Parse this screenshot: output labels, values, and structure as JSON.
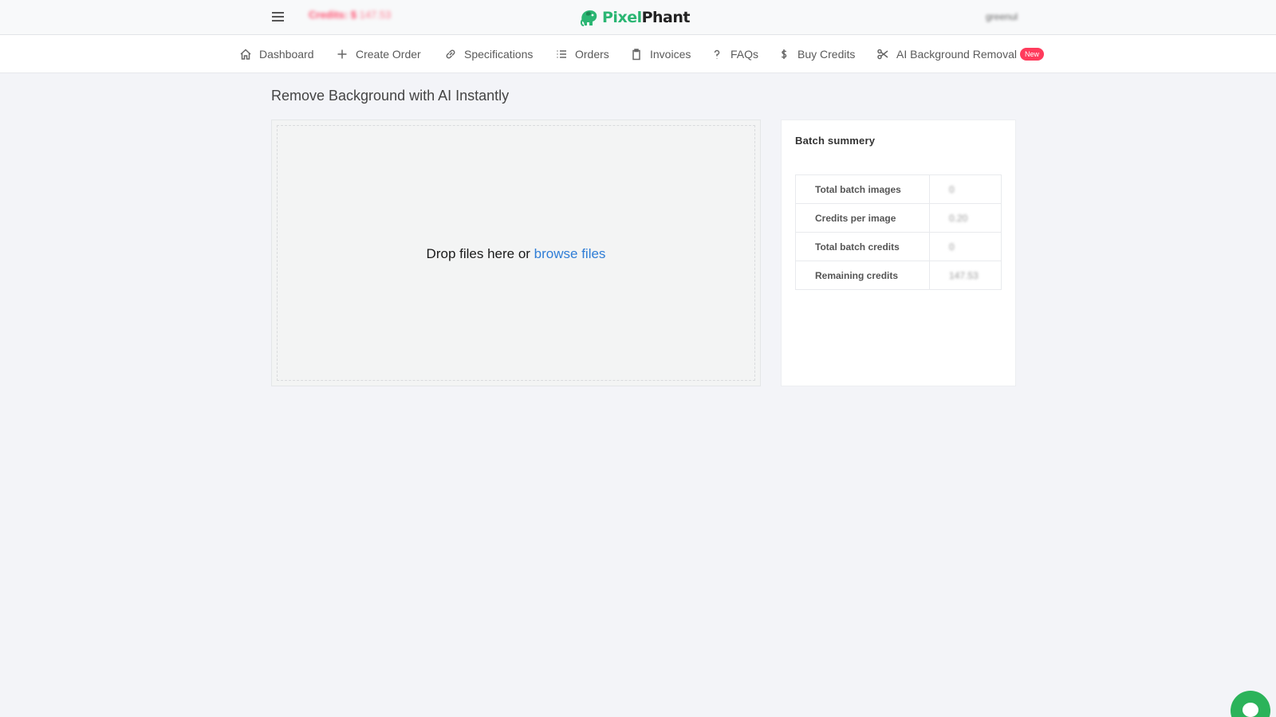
{
  "header": {
    "credits_label": "Credits: $",
    "credits_amount": "147.53",
    "logo_part1": "Pixel",
    "logo_part2": "Phant",
    "username": "greenul"
  },
  "nav": {
    "items": [
      {
        "label": "Dashboard",
        "icon": "home-icon"
      },
      {
        "label": "Create Order",
        "icon": "plus-icon"
      },
      {
        "label": "Specifications",
        "icon": "link-icon"
      },
      {
        "label": "Orders",
        "icon": "list-icon"
      },
      {
        "label": "Invoices",
        "icon": "clipboard-icon"
      },
      {
        "label": "FAQs",
        "icon": "question-icon"
      },
      {
        "label": "Buy Credits",
        "icon": "dollar-icon"
      },
      {
        "label": "AI Background Removal",
        "icon": "scissors-icon"
      }
    ],
    "new_badge": "New"
  },
  "page": {
    "title": "Remove Background with AI Instantly"
  },
  "dropzone": {
    "text": "Drop files here or",
    "link": "browse files"
  },
  "summary": {
    "title": "Batch summery",
    "rows": [
      {
        "label": "Total batch images",
        "value": "0"
      },
      {
        "label": "Credits per image",
        "value": "0.20"
      },
      {
        "label": "Total batch credits",
        "value": "0"
      },
      {
        "label": "Remaining credits",
        "value": "147.53"
      }
    ]
  },
  "colors": {
    "brand_green": "#2bb673",
    "link_blue": "#2f7dd6",
    "badge_red": "#ff3b5c",
    "credits_red": "#ff4d6d",
    "chat_green": "#2bb35a"
  }
}
